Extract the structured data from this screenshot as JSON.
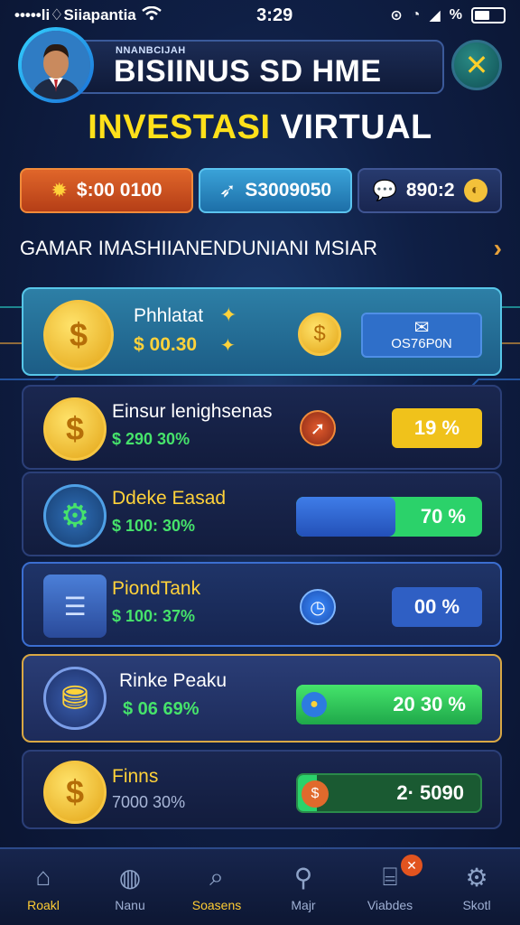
{
  "status_bar": {
    "carrier": "•••••li♢Siiapantia",
    "time": "3:29",
    "battery": "%"
  },
  "header": {
    "subtitle": "NNANBCIJAH",
    "title": "BISIINUS SD HME",
    "close_label": "✕"
  },
  "heading": {
    "part1": "INVESTASI",
    "part2": "VIRTUAL"
  },
  "currencies": [
    {
      "icon": "gear-coin-icon",
      "value": "$:00 0100"
    },
    {
      "icon": "paper-plane-icon",
      "value": "S3009050"
    },
    {
      "icon": "speech-bubble-icon",
      "value": "890:2"
    }
  ],
  "section": {
    "title": "GAMAR IMASHIIANENDUNIANI MSIAR",
    "chevron": "›"
  },
  "investments": [
    {
      "name": "Phhlatat",
      "value": "$ 00.30",
      "action": "OS76P0N",
      "featured": true
    },
    {
      "name": "Einsur lenighsenas",
      "value": "$ 290 30%",
      "pill": "19 %",
      "pill_color": "#f0c21b"
    },
    {
      "name": "Ddeke Easad",
      "value": "$ 100: 30%",
      "progress_label": "70 %",
      "progress": 0.55
    },
    {
      "name": "PiondTank",
      "value": "$ 100: 37%",
      "pill": "00 %",
      "pill_color": "#2f5fc4"
    },
    {
      "name": "Rinke Peaku",
      "value": "$ 06 69%",
      "progress_label": "20 30 %",
      "progress": 1.0
    },
    {
      "name": "Finns",
      "value": "7000 30%",
      "progress_label": "2· 5090",
      "progress": 0.1
    }
  ],
  "bottom_nav": [
    {
      "label": "Roakl",
      "icon": "home-icon",
      "active": true
    },
    {
      "label": "Nanu",
      "icon": "globe-icon"
    },
    {
      "label": "Soasens",
      "icon": "search-icon",
      "gold": true
    },
    {
      "label": "Majr",
      "icon": "magnifier-icon"
    },
    {
      "label": "Viabdes",
      "icon": "shop-icon",
      "badge": "✕"
    },
    {
      "label": "Skotl",
      "icon": "gear-icon"
    }
  ]
}
